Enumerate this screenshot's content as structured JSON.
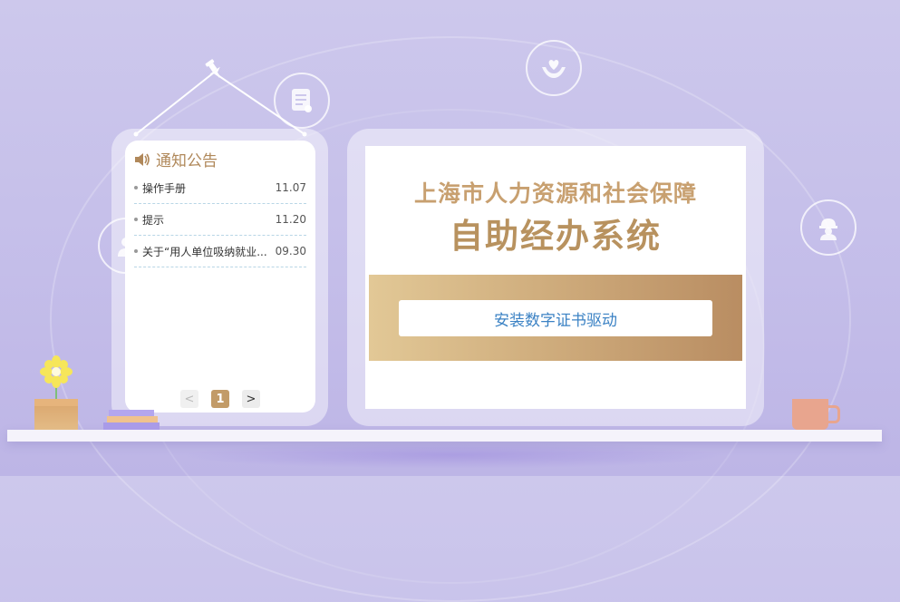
{
  "notice": {
    "title": "通知公告",
    "items": [
      {
        "title": "操作手册",
        "date": "11.07"
      },
      {
        "title": "提示",
        "date": "11.20"
      },
      {
        "title": "关于“用人单位吸纳就业...",
        "date": "09.30"
      }
    ],
    "pager": {
      "prev": "<",
      "current": "1",
      "next": ">"
    }
  },
  "system": {
    "line1": "上海市人力资源和社会保障",
    "line2": "自助经办系统",
    "install_button": "安装数字证书驱动"
  },
  "icons": [
    "pin-icon",
    "document-icon",
    "heart-hands-icon",
    "worker-helmet-icon",
    "person-icon",
    "speaker-icon",
    "flower-icon",
    "mug-icon"
  ],
  "colors": {
    "gold": "#b8925f",
    "gold_light": "#e2c896",
    "link_blue": "#3b82c4",
    "background": "#c6c0ea"
  }
}
